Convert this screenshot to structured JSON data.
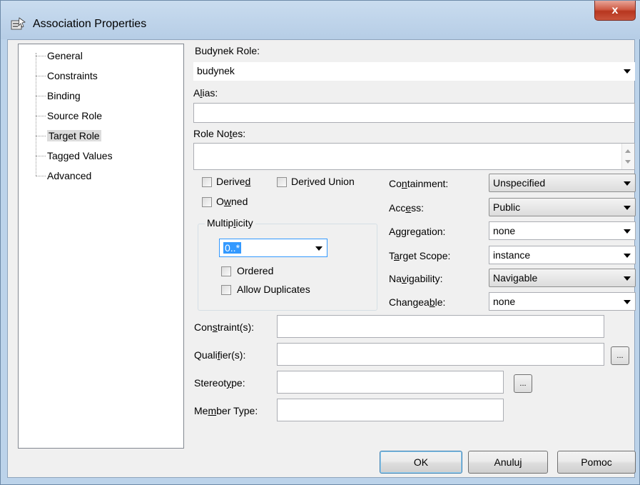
{
  "window": {
    "title": "Association Properties",
    "close_glyph": "x"
  },
  "tree": {
    "items": [
      {
        "label": "General"
      },
      {
        "label": "Constraints"
      },
      {
        "label": "Binding"
      },
      {
        "label": "Source Role"
      },
      {
        "label": "Target Role"
      },
      {
        "label": "Tagged Values"
      },
      {
        "label": "Advanced"
      }
    ],
    "selected": "Target Role"
  },
  "role": {
    "label": "Budynek Role:",
    "value": "budynek"
  },
  "alias": {
    "label_pre": "A",
    "label_u": "l",
    "label_post": "ias:",
    "value": ""
  },
  "role_notes": {
    "label_pre": "Role No",
    "label_u": "t",
    "label_post": "es:",
    "value": ""
  },
  "checkboxes": {
    "derived_pre": "Derive",
    "derived_u": "d",
    "derived_post": "",
    "derived_union_pre": "Der",
    "derived_union_u": "i",
    "derived_union_post": "ved Union",
    "owned_pre": "O",
    "owned_u": "w",
    "owned_post": "ned",
    "ordered": "Ordered",
    "allow_duplicates": "Allow Duplicates"
  },
  "multiplicity": {
    "title_pre": "Multip",
    "title_u": "l",
    "title_post": "icity",
    "value": "0..*"
  },
  "properties": [
    {
      "label_pre": "Co",
      "label_u": "n",
      "label_post": "tainment:",
      "value": "Unspecified"
    },
    {
      "label_pre": "Acc",
      "label_u": "e",
      "label_post": "ss:",
      "value": "Public"
    },
    {
      "label_pre": "A",
      "label_u": "g",
      "label_post": "gregation:",
      "value": "none"
    },
    {
      "label_pre": "T",
      "label_u": "a",
      "label_post": "rget Scope:",
      "value": "instance"
    },
    {
      "label_pre": "Na",
      "label_u": "v",
      "label_post": "igability:",
      "value": "Navigable"
    },
    {
      "label_pre": "Changea",
      "label_u": "b",
      "label_post": "le:",
      "value": "none"
    }
  ],
  "constraints": {
    "label_pre": "Con",
    "label_u": "s",
    "label_post": "traint(s):",
    "value": ""
  },
  "qualifiers": {
    "label_pre": "Quali",
    "label_u": "f",
    "label_post": "ier(s):",
    "value": "",
    "browse": "..."
  },
  "stereotype": {
    "label_pre": "Stereot",
    "label_u": "y",
    "label_post": "pe:",
    "value": "",
    "browse": "..."
  },
  "member_type": {
    "label_pre": "Me",
    "label_u": "m",
    "label_post": "ber Type:",
    "value": ""
  },
  "buttons": {
    "ok": "OK",
    "cancel": "Anuluj",
    "help": "Pomoc"
  }
}
